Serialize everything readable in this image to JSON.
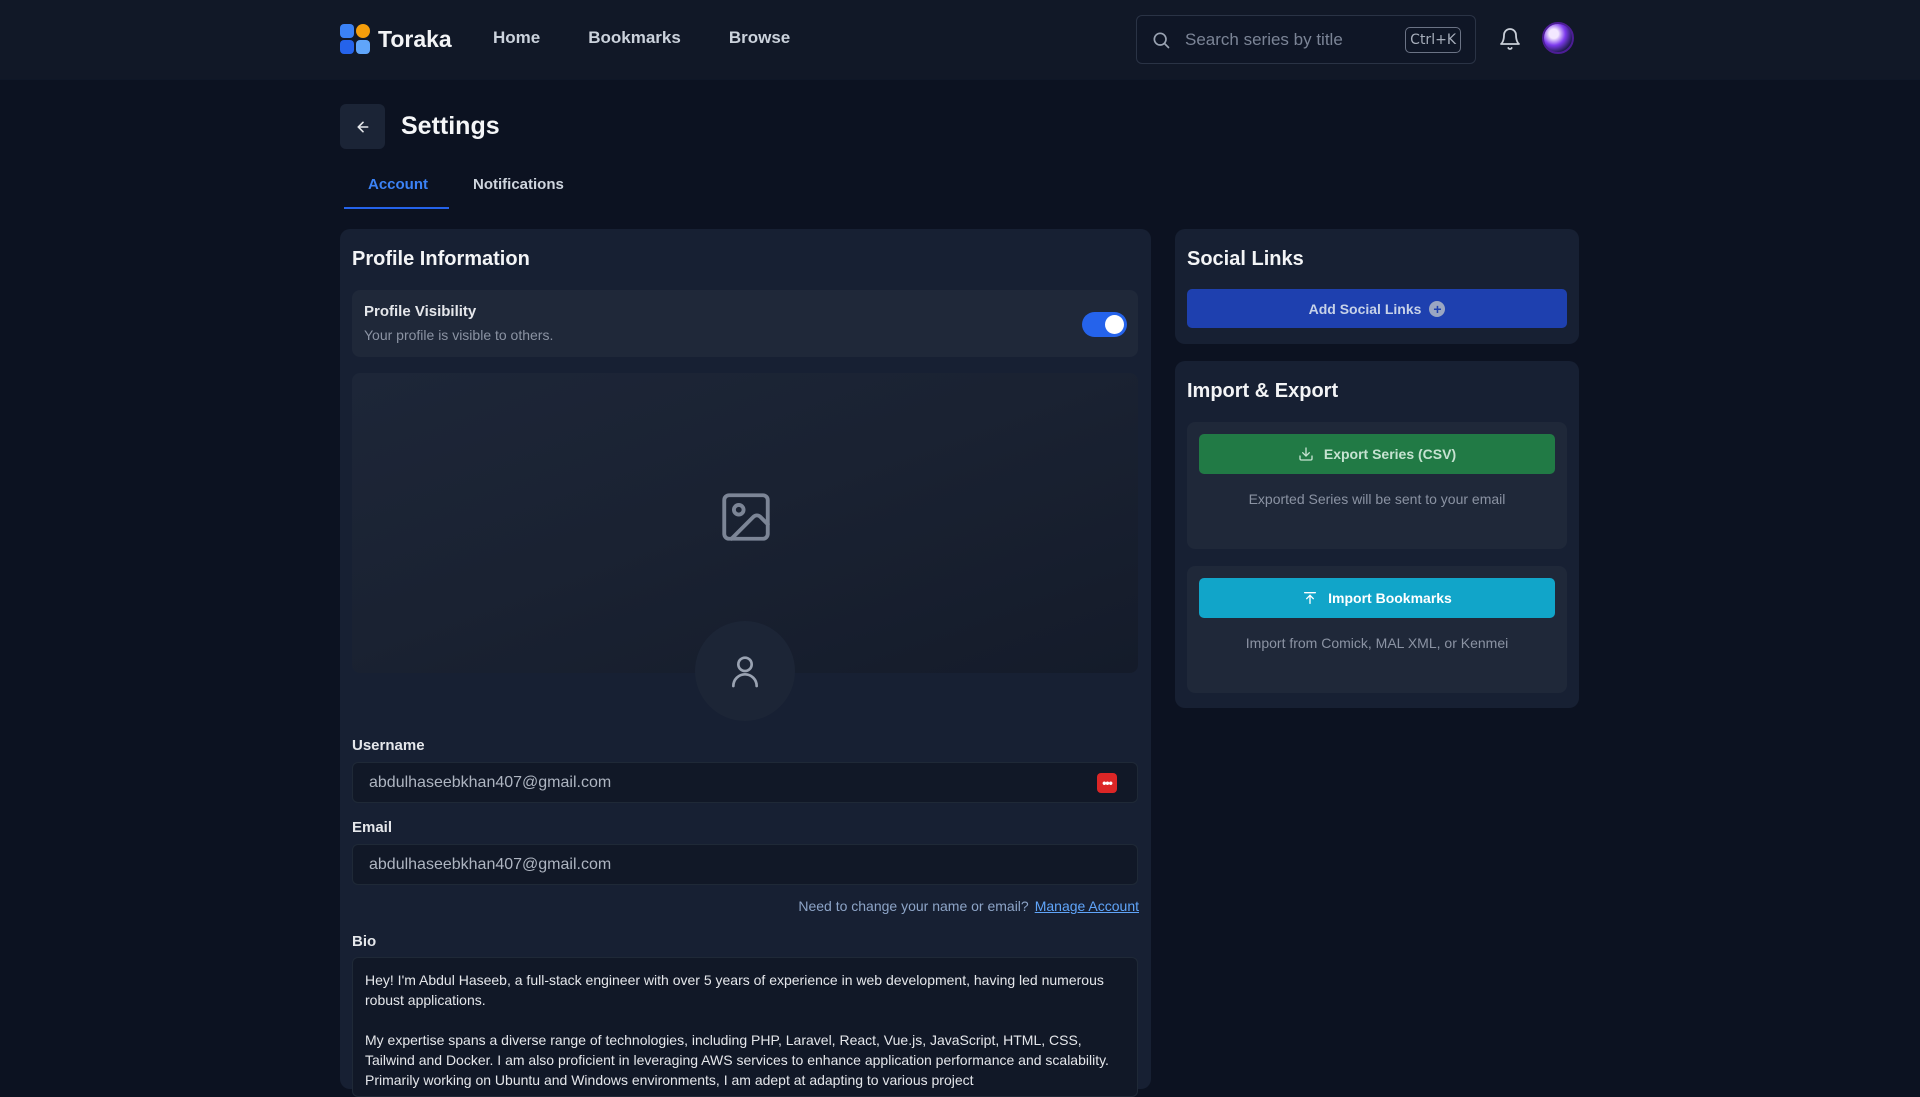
{
  "app": {
    "name": "Toraka",
    "nav": [
      "Home",
      "Bookmarks",
      "Browse"
    ],
    "search_placeholder": "Search series by title",
    "search_shortcut": "Ctrl+K"
  },
  "page": {
    "title": "Settings",
    "tabs": [
      {
        "label": "Account",
        "active": true
      },
      {
        "label": "Notifications",
        "active": false
      }
    ]
  },
  "profile": {
    "title": "Profile Information",
    "visibility": {
      "label": "Profile Visibility",
      "description": "Your profile is visible to others.",
      "enabled": true
    },
    "username_label": "Username",
    "username_value": "abdulhaseebkhan407@gmail.com",
    "email_label": "Email",
    "email_value": "abdulhaseebkhan407@gmail.com",
    "help_text": "Need to change your name or email?",
    "help_link": "Manage Account",
    "bio_label": "Bio",
    "bio_p1": "Hey! I'm Abdul Haseeb, a full-stack engineer with over 5 years of experience in web development, having led numerous robust applications.",
    "bio_p2": "My expertise spans a diverse range of technologies, including PHP, Laravel, React, Vue.js, JavaScript, HTML, CSS, Tailwind and Docker. I am also proficient in leveraging AWS services to enhance application performance and scalability. Primarily working on Ubuntu and Windows environments, I am adept at adapting to various project"
  },
  "social": {
    "title": "Social Links",
    "add_label": "Add Social Links"
  },
  "import_export": {
    "title": "Import & Export",
    "export_label": "Export Series (CSV)",
    "export_note": "Exported Series will be sent to your email",
    "import_label": "Import Bookmarks",
    "import_note": "Import from Comick, MAL XML, or Kenmei"
  },
  "colors": {
    "accent": "#2563eb",
    "export": "#217a45",
    "import": "#11a5c9",
    "background": "#0c1221",
    "card": "#172033"
  }
}
